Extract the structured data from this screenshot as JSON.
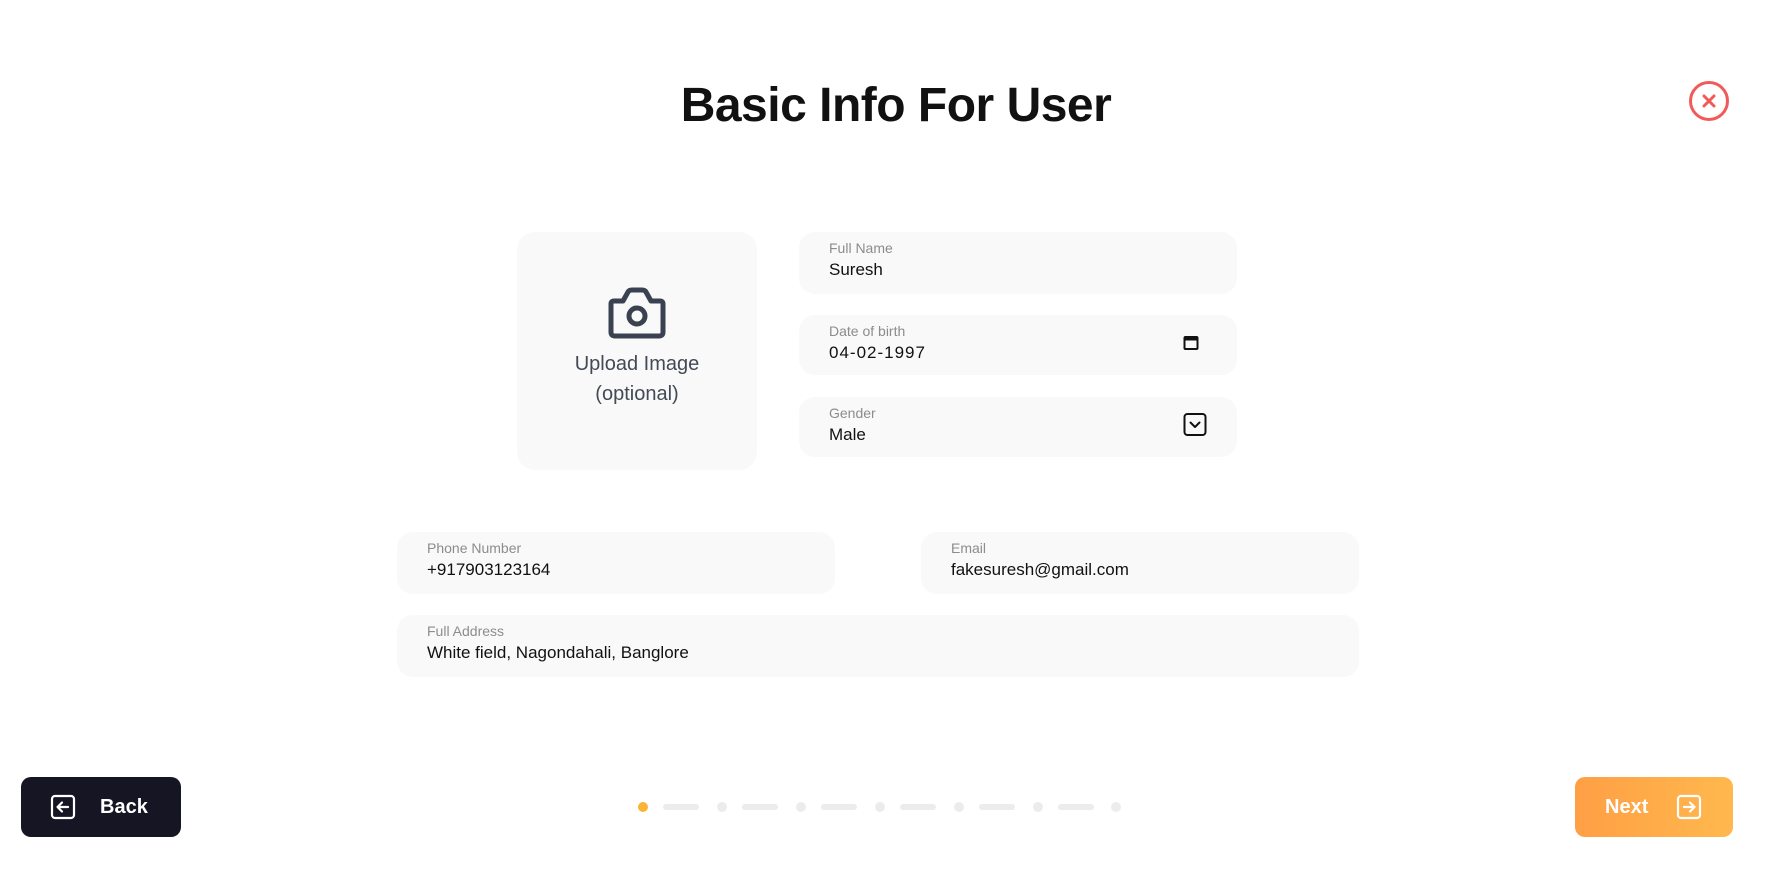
{
  "page": {
    "title": "Basic Info For User"
  },
  "upload": {
    "line1": "Upload Image",
    "line2": "(optional)"
  },
  "fields": {
    "full_name": {
      "label": "Full Name",
      "value": "Suresh"
    },
    "dob": {
      "label": "Date of birth",
      "value": "04-02-1997"
    },
    "gender": {
      "label": "Gender",
      "value": "Male"
    },
    "phone": {
      "label": "Phone Number",
      "value": "+917903123164"
    },
    "email": {
      "label": "Email",
      "value": "fakesuresh@gmail.com"
    },
    "address": {
      "label": "Full Address",
      "value": "White field, Nagondahali, Banglore"
    }
  },
  "nav": {
    "back_label": "Back",
    "next_label": "Next"
  },
  "stepper": {
    "current_step": 1,
    "total_steps": 7
  },
  "colors": {
    "accent": "#fbb437",
    "close": "#f25a5a",
    "back_button": "#151524",
    "next_button_start": "#ff9f45",
    "next_button_end": "#ffb84d"
  },
  "icons": {
    "close": "close-icon",
    "upload": "camera-icon",
    "dob": "calendar-icon",
    "gender": "chevron-down-icon",
    "back": "arrow-left-icon",
    "next": "arrow-right-icon"
  }
}
